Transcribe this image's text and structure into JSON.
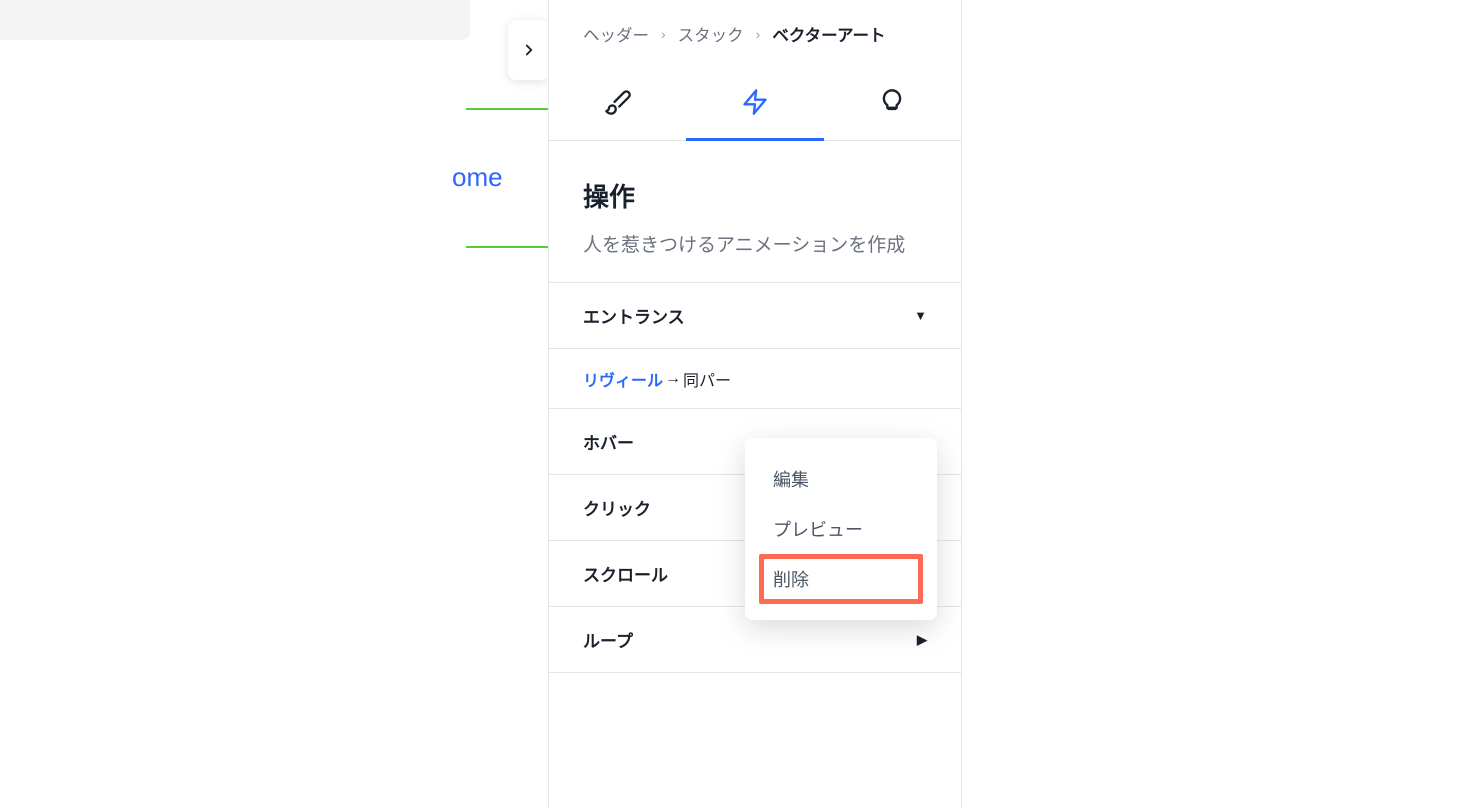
{
  "left": {
    "partial_text": "ome"
  },
  "breadcrumb": {
    "items": [
      "ヘッダー",
      "スタック"
    ],
    "current": "ベクターアート",
    "separator": "›"
  },
  "tabs": {
    "items": [
      {
        "name": "design",
        "icon": "brush-icon"
      },
      {
        "name": "interactions",
        "icon": "lightning-icon"
      },
      {
        "name": "help",
        "icon": "bulb-icon"
      }
    ],
    "active_index": 1
  },
  "section": {
    "title": "操作",
    "description": "人を惹きつけるアニメーションを作成"
  },
  "list": {
    "entrance": {
      "label": "エントランス",
      "expanded": true,
      "caret": "▼"
    },
    "reveal": {
      "link_label": "リヴィール",
      "arrow": "→",
      "text": "同パー"
    },
    "hover": {
      "label": "ホバー"
    },
    "click": {
      "label": "クリック"
    },
    "scroll": {
      "label": "スクロール",
      "caret": "▶"
    },
    "loop": {
      "label": "ループ",
      "caret": "▶"
    }
  },
  "context_menu": {
    "items": [
      "編集",
      "プレビュー",
      "削除"
    ],
    "highlighted_index": 2
  },
  "colors": {
    "accent": "#2b68ff",
    "highlight": "#ff6b52",
    "green": "#5cc93f"
  }
}
